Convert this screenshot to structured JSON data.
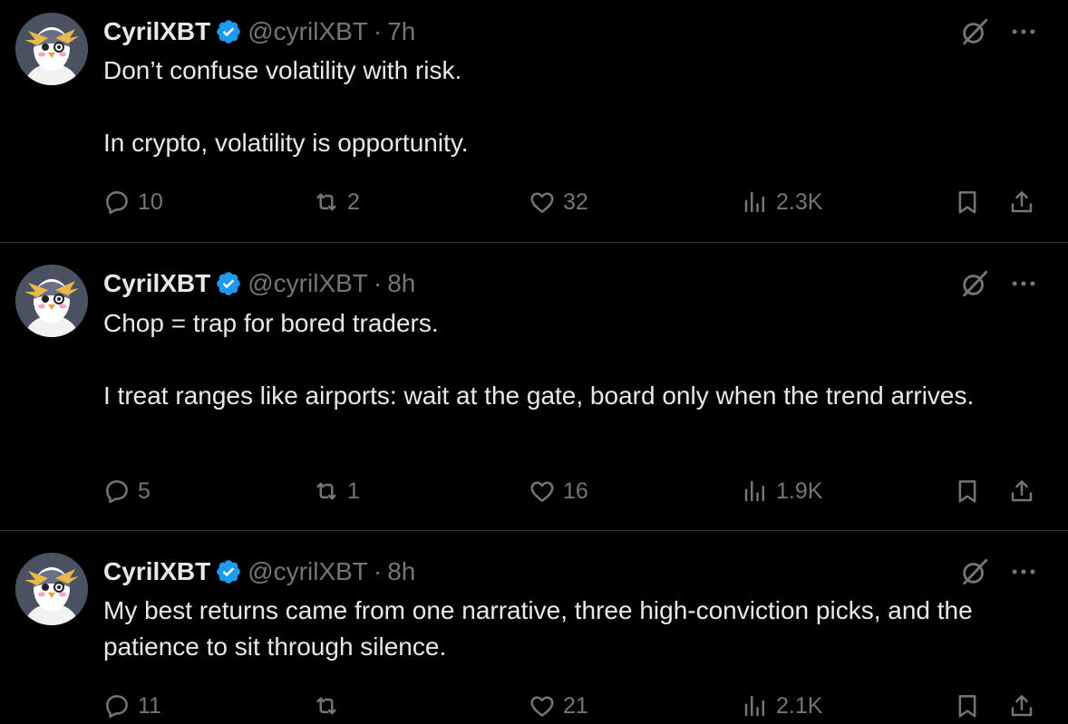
{
  "colors": {
    "background": "#000000",
    "text": "#e7e9ea",
    "secondary": "#71767b",
    "verified": "#1d9bf0",
    "divider": "#2f3336"
  },
  "tweets": [
    {
      "name": "CyrilXBT",
      "handle": "@cyrilXBT",
      "separator": "·",
      "time": "7h",
      "text": "Don’t confuse volatility with risk.\n\nIn crypto, volatility is opportunity.",
      "replies": "10",
      "retweets": "2",
      "likes": "32",
      "views": "2.3K"
    },
    {
      "name": "CyrilXBT",
      "handle": "@cyrilXBT",
      "separator": "·",
      "time": "8h",
      "text": "Chop = trap for bored traders.\n\nI treat ranges like airports: wait at the gate, board only when the trend arrives.",
      "replies": "5",
      "retweets": "1",
      "likes": "16",
      "views": "1.9K"
    },
    {
      "name": "CyrilXBT",
      "handle": "@cyrilXBT",
      "separator": "·",
      "time": "8h",
      "text": "My best returns came from one narrative, three high-conviction picks, and the patience to sit through silence.",
      "replies": "11",
      "retweets": "",
      "likes": "21",
      "views": "2.1K"
    }
  ]
}
